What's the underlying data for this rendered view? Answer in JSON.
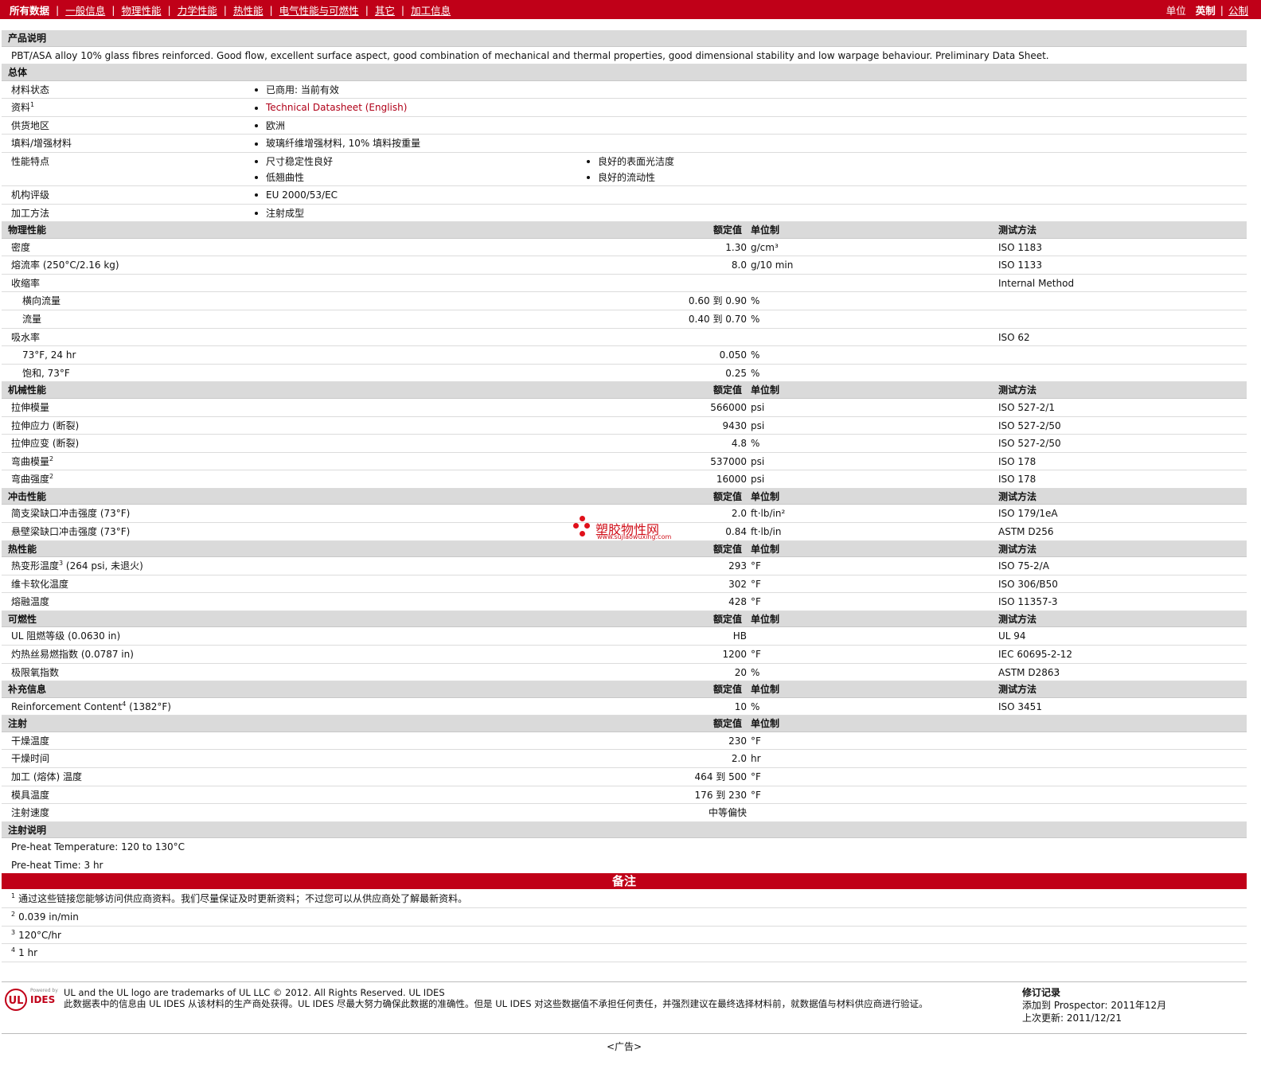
{
  "topbar": {
    "tabs": [
      "所有数据",
      "一般信息",
      "物理性能",
      "力学性能",
      "热性能",
      "电气性能与可燃性",
      "其它",
      "加工信息"
    ],
    "units_label": "单位",
    "units_selected": "英制",
    "units_other": "公制"
  },
  "desc": {
    "title": "产品说明",
    "text": "PBT/ASA alloy 10% glass fibres reinforced. Good flow, excellent surface aspect, good combination of mechanical and thermal properties, good dimensional stability and low warpage behaviour. Preliminary Data Sheet."
  },
  "general": {
    "title": "总体",
    "rows": [
      {
        "name": "材料状态",
        "value": "已商用: 当前有效"
      },
      {
        "name": "资料",
        "sup": "1",
        "value": "Technical Datasheet (English)"
      },
      {
        "name": "供货地区",
        "value": "欧洲"
      },
      {
        "name": "填料/增强材料",
        "value": "玻璃纤维增强材料, 10% 填料按重量"
      }
    ],
    "features": {
      "name": "性能特点",
      "left": [
        "尺寸稳定性良好",
        "低翘曲性"
      ],
      "right": [
        "良好的表面光洁度",
        "良好的流动性"
      ]
    },
    "rows2": [
      {
        "name": "机构评级",
        "value": "EU 2000/53/EC"
      },
      {
        "name": "加工方法",
        "value": "注射成型"
      }
    ]
  },
  "headers": {
    "value": "额定值",
    "unit": "单位制",
    "method": "测试方法"
  },
  "physical": {
    "title": "物理性能",
    "rows": [
      {
        "name": "密度",
        "value": "1.30",
        "unit": "g/cm³",
        "method": "ISO 1183"
      },
      {
        "name": "熔流率 (250°C/2.16 kg)",
        "value": "8.0",
        "unit": "g/10 min",
        "method": "ISO 1133"
      },
      {
        "name": "收缩率",
        "value": "",
        "unit": "",
        "method": "Internal Method"
      },
      {
        "name": "横向流量",
        "sub": true,
        "value": "0.60 到  0.90",
        "unit": "%",
        "method": ""
      },
      {
        "name": "流量",
        "sub": true,
        "value": "0.40 到  0.70",
        "unit": "%",
        "method": ""
      },
      {
        "name": "吸水率",
        "value": "",
        "unit": "",
        "method": "ISO 62"
      },
      {
        "name": "73°F, 24 hr",
        "sub": true,
        "value": "0.050",
        "unit": "%",
        "method": ""
      },
      {
        "name": "饱和, 73°F",
        "sub": true,
        "value": "0.25",
        "unit": "%",
        "method": ""
      }
    ]
  },
  "mechanical": {
    "title": "机械性能",
    "rows": [
      {
        "name": "拉伸模量",
        "value": "566000",
        "unit": "psi",
        "method": "ISO 527-2/1"
      },
      {
        "name": "拉伸应力 (断裂)",
        "value": "9430",
        "unit": "psi",
        "method": "ISO 527-2/50"
      },
      {
        "name": "拉伸应变 (断裂)",
        "value": "4.8",
        "unit": "%",
        "method": "ISO 527-2/50"
      },
      {
        "name": "弯曲模量",
        "sup": "2",
        "value": "537000",
        "unit": "psi",
        "method": "ISO 178"
      },
      {
        "name": "弯曲强度",
        "sup": "2",
        "value": "16000",
        "unit": "psi",
        "method": "ISO 178"
      }
    ]
  },
  "impact": {
    "title": "冲击性能",
    "rows": [
      {
        "name": "简支梁缺口冲击强度 (73°F)",
        "value": "2.0",
        "unit": "ft·lb/in²",
        "method": "ISO 179/1eA"
      },
      {
        "name": "悬壁梁缺口冲击强度 (73°F)",
        "value": "0.84",
        "unit": "ft·lb/in",
        "method": "ASTM D256"
      }
    ]
  },
  "thermal": {
    "title": "热性能",
    "rows": [
      {
        "name": "热变形温度",
        "sup": "3",
        "suffix": " (264 psi, 未退火)",
        "value": "293",
        "unit": "°F",
        "method": "ISO 75-2/A"
      },
      {
        "name": "维卡软化温度",
        "value": "302",
        "unit": "°F",
        "method": "ISO 306/B50"
      },
      {
        "name": "熔融温度",
        "value": "428",
        "unit": "°F",
        "method": "ISO 11357-3"
      }
    ]
  },
  "flammability": {
    "title": "可燃性",
    "rows": [
      {
        "name": "UL 阻燃等级 (0.0630 in)",
        "value": "HB",
        "unit": "",
        "method": "UL 94"
      },
      {
        "name": "灼热丝易燃指数 (0.0787 in)",
        "value": "1200",
        "unit": "°F",
        "method": "IEC 60695-2-12"
      },
      {
        "name": "极限氧指数",
        "value": "20",
        "unit": "%",
        "method": "ASTM D2863"
      }
    ]
  },
  "additional": {
    "title": "补充信息",
    "rows": [
      {
        "name": "Reinforcement Content",
        "sup": "4",
        "suffix": " (1382°F)",
        "value": "10",
        "unit": "%",
        "method": "ISO 3451"
      }
    ]
  },
  "injection": {
    "title": "注射",
    "rows": [
      {
        "name": "干燥温度",
        "value": "230",
        "unit": "°F",
        "method": ""
      },
      {
        "name": "干燥时间",
        "value": "2.0",
        "unit": "hr",
        "method": ""
      },
      {
        "name": "加工 (熔体) 温度",
        "value": "464 到  500",
        "unit": "°F",
        "method": ""
      },
      {
        "name": "模具温度",
        "value": "176 到  230",
        "unit": "°F",
        "method": ""
      },
      {
        "name": "注射速度",
        "value": "中等偏快",
        "unit": "",
        "method": ""
      }
    ]
  },
  "injection_notes": {
    "title": "注射说明",
    "lines": [
      "Pre-heat Temperature: 120 to 130°C",
      "Pre-heat Time: 3 hr"
    ]
  },
  "notes": {
    "title": "备注",
    "items": [
      {
        "n": "1",
        "text": "通过这些链接您能够访问供应商资料。我们尽量保证及时更新资料；不过您可以从供应商处了解最新资料。"
      },
      {
        "n": "2",
        "text": "0.039 in/min"
      },
      {
        "n": "3",
        "text": "120°C/hr"
      },
      {
        "n": "4",
        "text": "1 hr"
      }
    ]
  },
  "footer": {
    "powered": "Powered by",
    "logo_ul": "UL",
    "logo_ides": "IDES",
    "line1": "UL and the UL logo are trademarks of UL LLC © 2012. All Rights Reserved. UL IDES",
    "line2": "此数据表中的信息由 UL IDES 从该材料的生产商处获得。UL IDES 尽最大努力确保此数据的准确性。但是 UL IDES 对这些数据值不承担任何责任，并强烈建议在最终选择材料前，就数据值与材料供应商进行验证。",
    "rev_title": "修订记录",
    "rev_added": "添加到 Prospector:  2011年12月",
    "rev_updated": "上次更新:  2011/12/21"
  },
  "ad": "<广告>",
  "watermark": {
    "title": "塑胶物性网",
    "url": "www.sujiaowuxing.com"
  },
  "colors": {
    "brand_red": "#c00018",
    "section_gray": "#dadada"
  }
}
